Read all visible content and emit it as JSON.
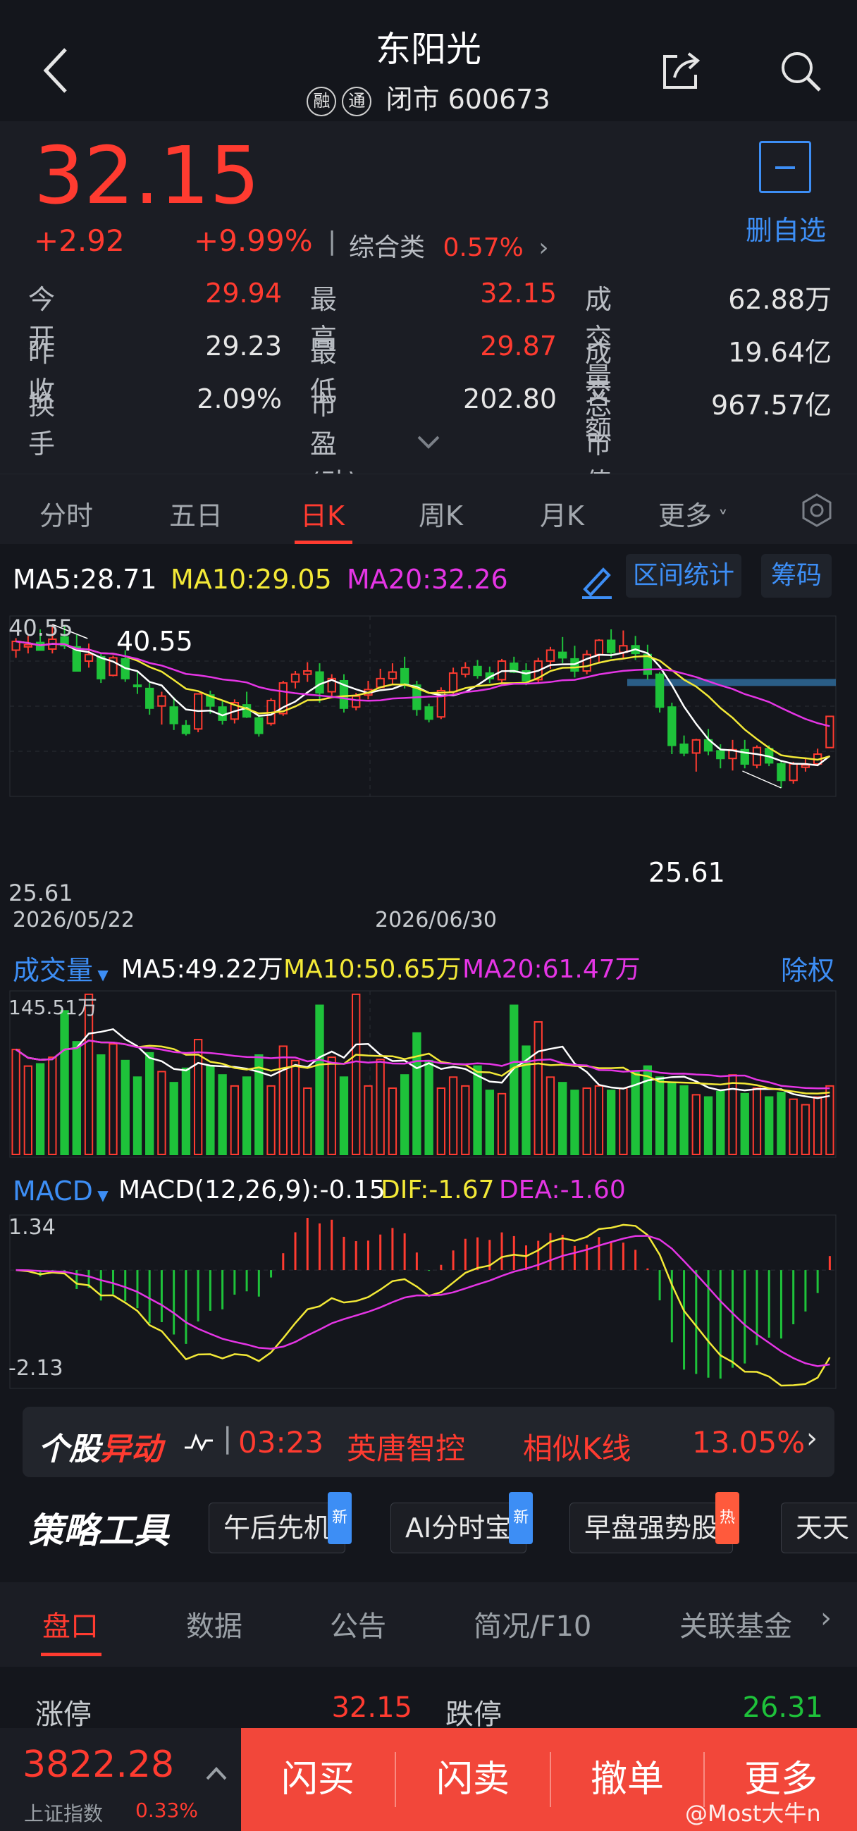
{
  "header": {
    "title": "东阳光",
    "badge1": "融",
    "badge2": "通",
    "status": "闭市",
    "code": "600673"
  },
  "quote": {
    "price": "32.15",
    "change": "+2.92",
    "change_pct": "+9.99%",
    "sector_label": "综合类",
    "sector_pct": "0.57%",
    "watch_label": "删自选",
    "rows": [
      {
        "l1": "今开",
        "v1": "29.94",
        "l2": "最高",
        "v2": "32.15",
        "l3": "成交量",
        "v3": "62.88万"
      },
      {
        "l1": "昨收",
        "v1": "29.23",
        "l2": "最低",
        "v2": "29.87",
        "l3": "成交额",
        "v3": "19.64亿"
      },
      {
        "l1": "换手",
        "v1": "2.09%",
        "l2": "市盈(动)",
        "v2": "202.80",
        "l3": "总市值",
        "v3": "967.57亿"
      }
    ]
  },
  "ktabs": [
    "分时",
    "五日",
    "日K",
    "周K",
    "月K",
    "更多"
  ],
  "ma": {
    "ma5": "MA5:28.71",
    "ma10": "MA10:29.05",
    "ma20": "MA20:32.26",
    "range_stats": "区间统计",
    "chips": "筹码"
  },
  "kline": {
    "ymax_label": "40.55",
    "ymin_label": "25.61",
    "high_annot": "40.55",
    "low_annot": "25.61",
    "date1": "2026/05/22",
    "date2": "2026/06/30"
  },
  "volume": {
    "label": "成交量",
    "ma5": "MA5:49.22万",
    "ma10": "MA10:50.65万",
    "ma20": "MA20:61.47万",
    "ymax_label": "145.51万",
    "adjust": "除权"
  },
  "macd": {
    "label": "MACD",
    "macd": "MACD(12,26,9):-0.15",
    "dif": "DIF:-1.67",
    "dea": "DEA:-1.60",
    "ymax_label": "1.34",
    "ymin_label": "-2.13"
  },
  "banner": {
    "brand1": "个股",
    "brand2": "异动",
    "time": "03:23",
    "name": "英唐智控",
    "type": "相似K线",
    "pct": "13.05%"
  },
  "tools": {
    "title": "策略工具",
    "items": [
      {
        "label": "午后先机",
        "tag": "新"
      },
      {
        "label": "AI分时宝",
        "tag": "新"
      },
      {
        "label": "早盘强势股",
        "tag": "热"
      },
      {
        "label": "天天",
        "tag": ""
      }
    ]
  },
  "sectabs": [
    "盘口",
    "数据",
    "公告",
    "简况/F10",
    "关联基金"
  ],
  "limits": {
    "up_label": "涨停",
    "up_val": "32.15",
    "down_label": "跌停",
    "down_val": "26.31"
  },
  "bottom": {
    "index_val": "3822.28",
    "index_name": "上证指数",
    "index_pct": "0.33%",
    "actions": [
      "闪买",
      "闪卖",
      "撤单",
      "更多"
    ],
    "watermark": "@Most大牛n"
  },
  "colors": {
    "up": "#ff3b30",
    "down": "#1ec23a",
    "ma5": "#ffffff",
    "ma10": "#f3e937",
    "ma20": "#e535e5",
    "accent": "#3d8ef5",
    "action_bg": "#f2473a"
  },
  "chart_data": {
    "type": "candlestick",
    "candles": [
      [
        38.2,
        39.3,
        37.5,
        39.0
      ],
      [
        38.5,
        39.5,
        37.9,
        38.7
      ],
      [
        38.9,
        40.1,
        38.2,
        38.2
      ],
      [
        38.3,
        40.55,
        37.9,
        39.2
      ],
      [
        39.4,
        40.4,
        38.3,
        38.6
      ],
      [
        38.5,
        39.6,
        37.7,
        36.3
      ],
      [
        37.2,
        38.8,
        36.6,
        37.8
      ],
      [
        37.6,
        37.9,
        35.2,
        35.6
      ],
      [
        35.9,
        37.7,
        35.8,
        37.5
      ],
      [
        37.4,
        38.2,
        35.3,
        35.6
      ],
      [
        35.0,
        36.3,
        34.2,
        34.9
      ],
      [
        34.7,
        35.2,
        32.3,
        32.9
      ],
      [
        33.1,
        34.4,
        31.4,
        34.0
      ],
      [
        33.0,
        33.9,
        30.9,
        31.5
      ],
      [
        31.3,
        31.8,
        30.4,
        30.6
      ],
      [
        31.0,
        34.2,
        30.7,
        34.2
      ],
      [
        34.1,
        34.5,
        32.4,
        33.1
      ],
      [
        33.0,
        33.6,
        31.4,
        31.8
      ],
      [
        31.9,
        33.7,
        31.5,
        33.4
      ],
      [
        33.2,
        34.4,
        32.0,
        32.1
      ],
      [
        32.0,
        32.3,
        30.3,
        30.6
      ],
      [
        31.5,
        33.8,
        31.3,
        33.6
      ],
      [
        32.4,
        35.4,
        32.2,
        35.2
      ],
      [
        35.3,
        36.3,
        34.7,
        36.0
      ],
      [
        36.0,
        37.1,
        35.3,
        36.3
      ],
      [
        36.2,
        37.0,
        33.4,
        34.3
      ],
      [
        34.4,
        36.0,
        34.0,
        35.6
      ],
      [
        35.4,
        36.0,
        32.5,
        32.9
      ],
      [
        33.0,
        34.3,
        32.7,
        34.0
      ],
      [
        34.1,
        35.4,
        33.7,
        34.6
      ],
      [
        34.8,
        36.5,
        34.7,
        35.6
      ],
      [
        35.6,
        37.0,
        35.0,
        36.2
      ],
      [
        36.5,
        37.6,
        34.7,
        35.0
      ],
      [
        35.0,
        35.4,
        32.2,
        32.8
      ],
      [
        33.0,
        33.3,
        31.6,
        31.9
      ],
      [
        32.1,
        34.8,
        31.9,
        34.5
      ],
      [
        34.4,
        36.6,
        34.2,
        36.1
      ],
      [
        36.0,
        37.1,
        35.7,
        36.6
      ],
      [
        36.7,
        37.3,
        35.6,
        35.9
      ],
      [
        36.1,
        36.7,
        35.2,
        35.6
      ],
      [
        35.5,
        37.4,
        35.2,
        37.2
      ],
      [
        37.0,
        37.6,
        36.1,
        36.2
      ],
      [
        36.3,
        37.0,
        35.0,
        35.4
      ],
      [
        35.5,
        37.5,
        35.2,
        37.2
      ],
      [
        37.2,
        38.5,
        36.5,
        38.2
      ],
      [
        38.0,
        39.4,
        37.0,
        37.5
      ],
      [
        37.4,
        38.6,
        35.7,
        36.3
      ],
      [
        36.3,
        38.2,
        36.0,
        37.8
      ],
      [
        37.8,
        39.2,
        37.1,
        39.1
      ],
      [
        39.1,
        40.1,
        37.5,
        38.0
      ],
      [
        38.0,
        40.0,
        37.4,
        38.6
      ],
      [
        38.6,
        39.5,
        37.3,
        37.9
      ],
      [
        37.8,
        38.7,
        35.5,
        36.0
      ],
      [
        36.0,
        36.2,
        32.5,
        33.0
      ],
      [
        33.0,
        33.4,
        28.7,
        29.5
      ],
      [
        29.6,
        30.4,
        28.5,
        28.8
      ],
      [
        28.8,
        30.1,
        27.1,
        30.0
      ],
      [
        30.0,
        31.0,
        28.6,
        29.0
      ],
      [
        29.0,
        29.6,
        27.4,
        28.3
      ],
      [
        28.3,
        30.0,
        27.2,
        29.1
      ],
      [
        29.1,
        30.0,
        27.4,
        27.8
      ],
      [
        27.7,
        29.5,
        27.4,
        29.3
      ],
      [
        29.2,
        29.5,
        27.6,
        27.9
      ],
      [
        27.8,
        28.1,
        25.61,
        26.3
      ],
      [
        26.3,
        28.0,
        26.0,
        27.8
      ],
      [
        27.5,
        28.3,
        27.1,
        27.7
      ],
      [
        27.8,
        29.2,
        27.6,
        28.7
      ],
      [
        29.3,
        32.15,
        29.87,
        32.15
      ]
    ],
    "ylim": [
      25.61,
      40.55
    ],
    "x_ticks": [
      "2026/05/22",
      "2026/06/30"
    ],
    "ma_lines": [
      "MA5",
      "MA10",
      "MA20"
    ],
    "volume": {
      "ymax": 145.51,
      "values": [
        95,
        80,
        82,
        88,
        130,
        102,
        145,
        90,
        100,
        85,
        70,
        92,
        75,
        65,
        78,
        104,
        80,
        72,
        62,
        70,
        90,
        62,
        98,
        85,
        60,
        135,
        88,
        70,
        145,
        62,
        86,
        60,
        72,
        110,
        85,
        60,
        70,
        62,
        80,
        58,
        55,
        135,
        98,
        120,
        70,
        65,
        58,
        60,
        62,
        58,
        60,
        75,
        80,
        70,
        65,
        62,
        54,
        52,
        57,
        72,
        55,
        60,
        52,
        56,
        50,
        45,
        52,
        62
      ]
    },
    "macd": {
      "ylim": [
        -2.13,
        1.34
      ]
    }
  }
}
